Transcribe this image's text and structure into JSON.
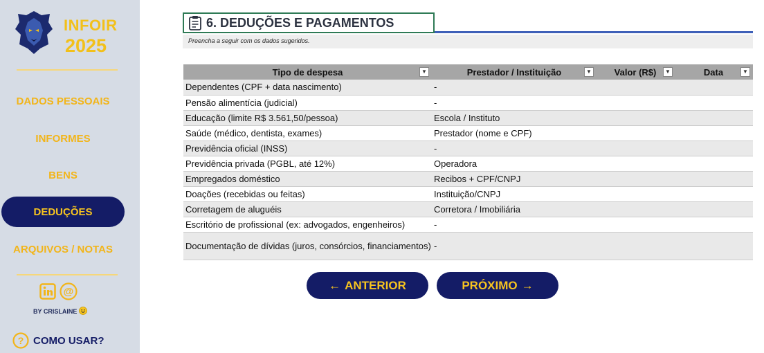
{
  "sidebar": {
    "brand_line1": "INFOIR",
    "brand_line2": "2025",
    "logo_icon": "lion-head-icon",
    "items": [
      {
        "label": "DADOS PESSOAIS",
        "active": false
      },
      {
        "label": "INFORMES",
        "active": false
      },
      {
        "label": "BENS",
        "active": false
      },
      {
        "label": "DEDUÇÕES",
        "active": true
      },
      {
        "label": "ARQUIVOS / NOTAS",
        "active": false
      }
    ],
    "social": {
      "linkedin_icon": "in",
      "email_icon": "@"
    },
    "by": "BY CRISLAINE",
    "help_label": "COMO USAR?",
    "help_icon": "?"
  },
  "section": {
    "title": "6. DEDUÇÕES E PAGAMENTOS",
    "subtitle": "Preencha a seguir com os dados sugeridos."
  },
  "table": {
    "headers": [
      "Tipo de despesa",
      "Prestador / Instituição",
      "Valor (R$)",
      "Data"
    ],
    "rows": [
      [
        "Dependentes (CPF + data nascimento)",
        "-",
        "",
        ""
      ],
      [
        "Pensão alimentícia (judicial)",
        "-",
        "",
        ""
      ],
      [
        "Educação (limite R$ 3.561,50/pessoa)",
        "Escola / Instituto",
        "",
        ""
      ],
      [
        "Saúde (médico, dentista, exames)",
        "Prestador (nome e CPF)",
        "",
        ""
      ],
      [
        "Previdência oficial (INSS)",
        "-",
        "",
        ""
      ],
      [
        "Previdência privada (PGBL, até 12%)",
        "Operadora",
        "",
        ""
      ],
      [
        "Empregados doméstico",
        "Recibos + CPF/CNPJ",
        "",
        ""
      ],
      [
        "Doações (recebidas ou feitas)",
        "Instituição/CNPJ",
        "",
        ""
      ],
      [
        "Corretagem de aluguéis",
        "Corretora / Imobiliária",
        "",
        ""
      ],
      [
        "Escritório de profissional (ex: advogados, engenheiros)",
        "-",
        "",
        ""
      ],
      [
        "Documentação de dívidas (juros, consórcios, financiamentos)",
        "-",
        "",
        ""
      ]
    ]
  },
  "nav": {
    "prev_label": "ANTERIOR",
    "next_label": "PRÓXIMO"
  },
  "colors": {
    "sidebar_bg": "#d6dce5",
    "accent_navy": "#141c66",
    "accent_gold": "#f2b51a"
  }
}
